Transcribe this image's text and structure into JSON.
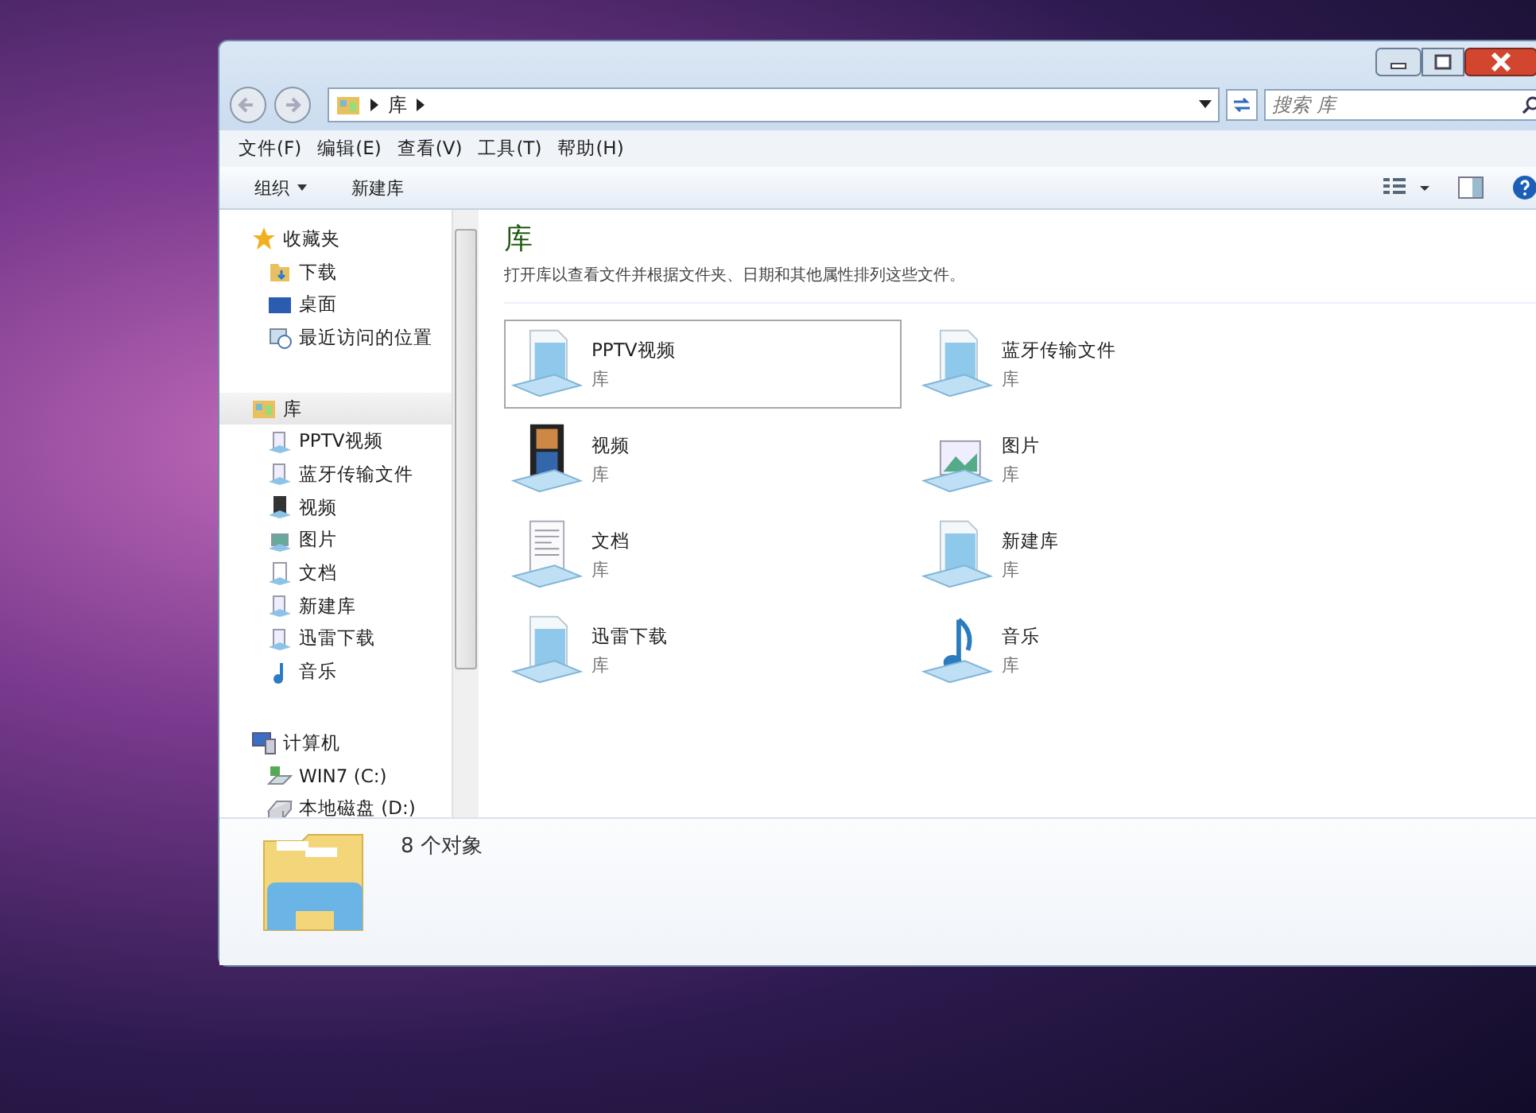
{
  "address": {
    "path": [
      "库"
    ],
    "search_placeholder": "搜索 库"
  },
  "menu": [
    "文件(F)",
    "编辑(E)",
    "查看(V)",
    "工具(T)",
    "帮助(H)"
  ],
  "toolbar": {
    "organize": "组织",
    "new_library": "新建库"
  },
  "sidebar": [
    {
      "label": "收藏夹",
      "kind": "star",
      "selected": false,
      "children": [
        {
          "label": "下载",
          "kind": "download"
        },
        {
          "label": "桌面",
          "kind": "desktop"
        },
        {
          "label": "最近访问的位置",
          "kind": "recent"
        }
      ]
    },
    {
      "label": "库",
      "kind": "libraries",
      "selected": true,
      "children": [
        {
          "label": "PPTV视频",
          "kind": "library"
        },
        {
          "label": "蓝牙传输文件",
          "kind": "library"
        },
        {
          "label": "视频",
          "kind": "video"
        },
        {
          "label": "图片",
          "kind": "pictures"
        },
        {
          "label": "文档",
          "kind": "documents"
        },
        {
          "label": "新建库",
          "kind": "library"
        },
        {
          "label": "迅雷下载",
          "kind": "library"
        },
        {
          "label": "音乐",
          "kind": "music"
        }
      ]
    },
    {
      "label": "计算机",
      "kind": "computer",
      "selected": false,
      "children": [
        {
          "label": "WIN7 (C:)",
          "kind": "system-drive"
        },
        {
          "label": "本地磁盘 (D:)",
          "kind": "drive"
        }
      ]
    }
  ],
  "content": {
    "title": "库",
    "description": "打开库以查看文件并根据文件夹、日期和其他属性排列这些文件。",
    "items": [
      {
        "name": "PPTV视频",
        "type": "库",
        "kind": "library",
        "selected": true
      },
      {
        "name": "蓝牙传输文件",
        "type": "库",
        "kind": "library",
        "selected": false
      },
      {
        "name": "视频",
        "type": "库",
        "kind": "video",
        "selected": false
      },
      {
        "name": "图片",
        "type": "库",
        "kind": "pictures",
        "selected": false
      },
      {
        "name": "文档",
        "type": "库",
        "kind": "documents",
        "selected": false
      },
      {
        "name": "新建库",
        "type": "库",
        "kind": "library",
        "selected": false
      },
      {
        "name": "迅雷下载",
        "type": "库",
        "kind": "library",
        "selected": false
      },
      {
        "name": "音乐",
        "type": "库",
        "kind": "music",
        "selected": false
      }
    ]
  },
  "details": {
    "count": "8 个对象"
  }
}
